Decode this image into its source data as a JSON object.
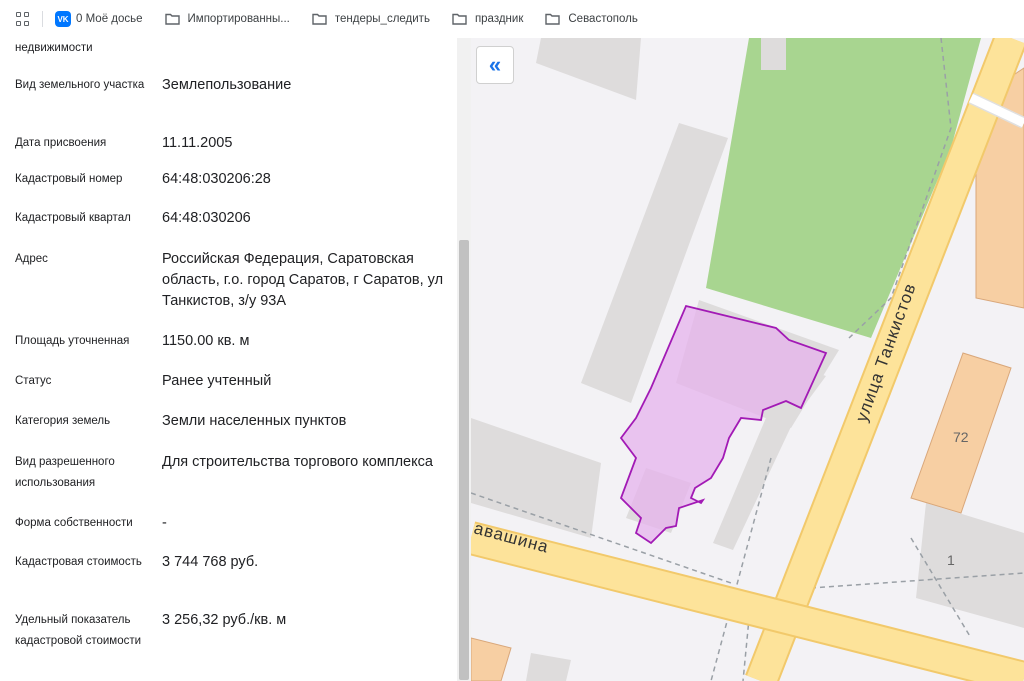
{
  "bookmarks": [
    {
      "label": "0 Моё досье",
      "icon": "vk-icon"
    },
    {
      "label": "Импортированны...",
      "icon": "folder-icon"
    },
    {
      "label": "тендеры_следить",
      "icon": "folder-icon"
    },
    {
      "label": "праздник",
      "icon": "folder-icon"
    },
    {
      "label": "Севастополь",
      "icon": "folder-icon"
    }
  ],
  "vk_badge": "VK",
  "details": {
    "partial_label": "недвижимости",
    "rows": [
      {
        "label": "Вид земельного участка",
        "value": "Землепользование"
      },
      {
        "label": "Дата присвоения",
        "value": "11.11.2005"
      },
      {
        "label": "Кадастровый номер",
        "value": "64:48:030206:28"
      },
      {
        "label": "Кадастровый квартал",
        "value": "64:48:030206"
      },
      {
        "label": "Адрес",
        "value": "Российская Федерация, Саратовская область, г.о. город Саратов, г Саратов, ул Танкистов, з/у 93А"
      },
      {
        "label": "Площадь уточненная",
        "value": "1150.00 кв. м"
      },
      {
        "label": "Статус",
        "value": "Ранее учтенный"
      },
      {
        "label": "Категория земель",
        "value": "Земли населенных пунктов"
      },
      {
        "label": "Вид разрешенного использования",
        "value": "Для строительства торгового комплекса"
      },
      {
        "label": "Форма собственности",
        "value": "-"
      },
      {
        "label": "Кадастровая стоимость",
        "value": "3 744 768 руб."
      },
      {
        "label": "Удельный показатель кадастровой стоимости",
        "value": "3 256,32 руб./кв. м"
      }
    ]
  },
  "map": {
    "collapse_label": "«",
    "street_tankistov": "улица Танкистов",
    "street_partial": "авашина",
    "building_72": "72",
    "building_1": "1",
    "colors": {
      "road": "#fde39a",
      "road_edge": "#f2c96b",
      "park": "#a8d590",
      "building": "#dedcdc",
      "building_orange": "#f7cfa3",
      "parcel_fill": "#e6b3ec",
      "parcel_stroke": "#a21ab5"
    }
  }
}
